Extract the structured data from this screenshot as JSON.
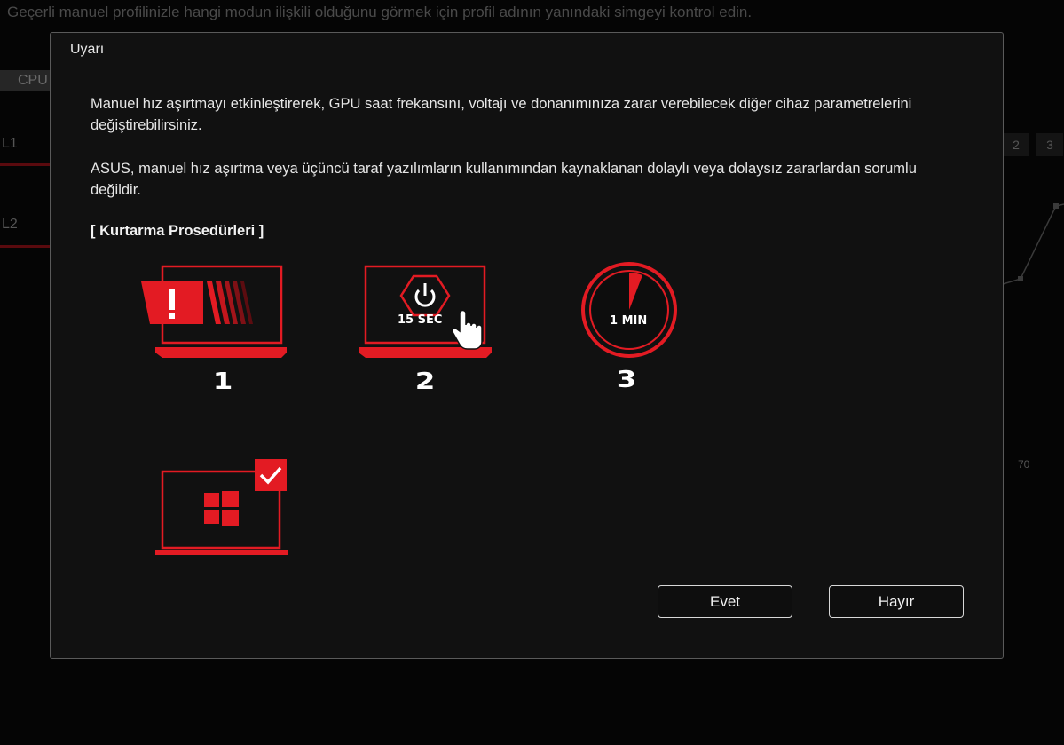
{
  "background": {
    "hint_text": "Geçerli manuel profilinizle hangi modun ilişkili olduğunu görmek için profil adının yanındaki simgeyi kontrol edin.",
    "tab_label": "CPU",
    "row_labels": [
      "L1",
      "L2"
    ],
    "right_tabs": [
      "2",
      "3"
    ],
    "axis_value": "70"
  },
  "dialog": {
    "title": "Uyarı",
    "paragraph_1": "Manuel hız aşırtmayı etkinleştirerek, GPU saat frekansını, voltajı ve donanımınıza zarar verebilecek diğer cihaz parametrelerini değiştirebilirsiniz.",
    "paragraph_2": "ASUS, manuel hız aşırtma veya üçüncü taraf yazılımların kullanımından kaynaklanan dolaylı veya dolaysız zararlardan sorumlu değildir.",
    "recovery_title": "[ Kurtarma Prosedürleri ]",
    "steps": [
      {
        "number": "1",
        "icon": "laptop-warning-icon"
      },
      {
        "number": "2",
        "icon": "laptop-power-press-icon",
        "caption": "15 SEC"
      },
      {
        "number": "3",
        "icon": "timer-icon",
        "caption": "1 MIN"
      },
      {
        "icon": "laptop-windows-check-icon"
      }
    ],
    "buttons": {
      "yes": "Evet",
      "no": "Hayır"
    }
  },
  "colors": {
    "accent": "#e31b23",
    "dialog_bg": "#111111",
    "text": "#e6e6e6"
  }
}
